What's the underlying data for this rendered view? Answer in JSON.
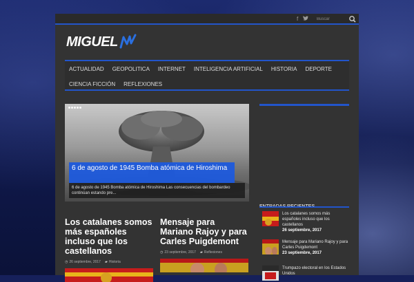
{
  "header": {
    "social_icons": [
      "facebook-icon",
      "twitter-icon"
    ],
    "search_placeholder": "Buscar",
    "logo_text": "MIGUEL",
    "accent": "#2255cc"
  },
  "nav": {
    "row1": [
      "ACTUALIDAD",
      "GEOPOLITICA",
      "INTERNET",
      "INTELIGENCIA ARTIFICIAL",
      "HISTORIA",
      "DEPORTE"
    ],
    "row2": [
      "CIENCIA FICCIÓN",
      "REFLEXIONES"
    ]
  },
  "slider": {
    "title": "6 de agosto de 1945 Bomba atómica de Hiroshima",
    "excerpt": "6 de agosto de 1945 Bomba atómica de Hiroshima Las consecuencias del bombardeo continúan estando pre..."
  },
  "articles": [
    {
      "title": "Los catalanes somos más españoles incluso que los castellanos",
      "date": "26 septiembre, 2017",
      "category": "Historia"
    },
    {
      "title": "Mensaje para Mariano Rajoy y para Carles Puigdemont",
      "date": "23 septiembre, 2017",
      "category": "Reflexiones"
    }
  ],
  "sidebar": {
    "recent_heading": "ENTRADAS RECIENTES",
    "recent": [
      {
        "title": "Los catalanes somos más españoles incluso que los castellanos",
        "date": "26 septiembre, 2017"
      },
      {
        "title": "Mensaje para Mariano Rajoy y para Carles Puigdemont",
        "date": "23 septiembre, 2017"
      },
      {
        "title": "Trumpazo electoral en los Estados Unidos",
        "date": ""
      }
    ]
  }
}
